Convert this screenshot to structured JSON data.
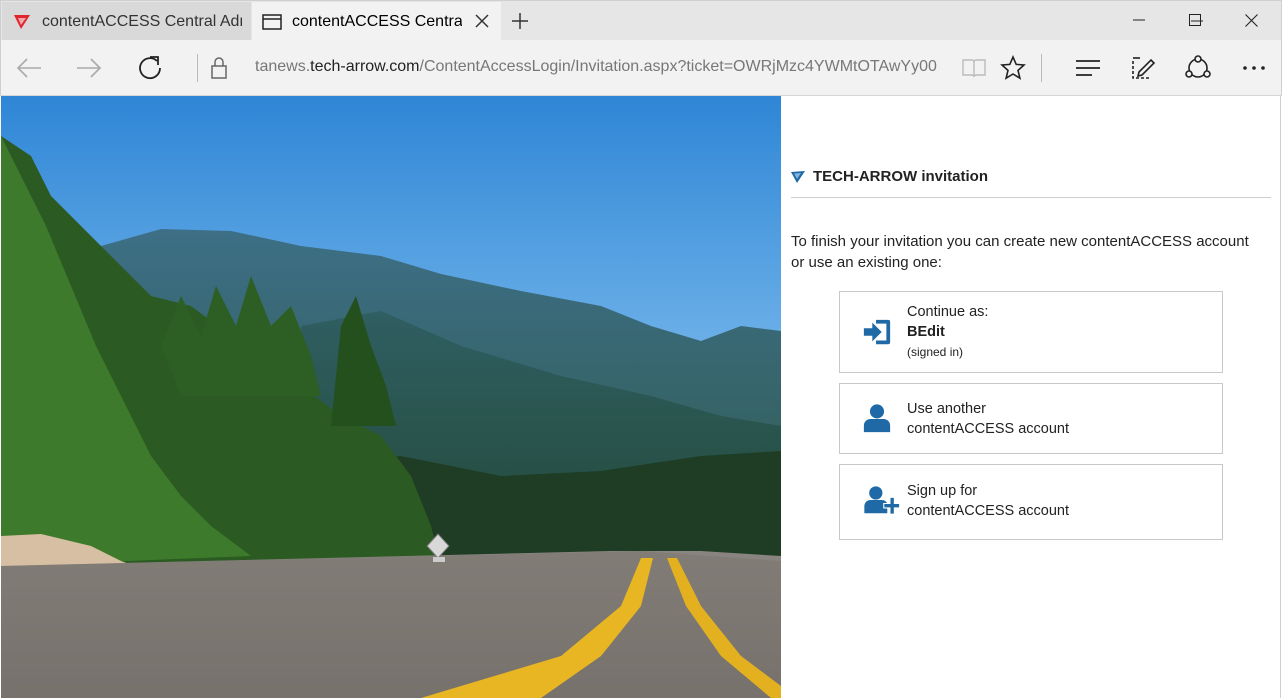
{
  "browser": {
    "tabs": [
      {
        "title": "contentACCESS Central Adn",
        "icon": "tech-arrow-logo-icon",
        "active": false
      },
      {
        "title": "contentACCESS Central",
        "icon": "page-icon",
        "active": true
      }
    ],
    "address": {
      "prefix": "tanews.",
      "host": "tech-arrow.com",
      "path": "/ContentAccessLogin/Invitation.aspx?ticket=OWRjMzc4YWMtOTAwYy00"
    },
    "toolbar_icons": [
      "back-icon",
      "forward-icon",
      "refresh-icon",
      "lock-icon",
      "reading-view-icon",
      "favorite-star-icon",
      "hub-icon",
      "web-note-icon",
      "share-icon",
      "more-icon"
    ],
    "window_controls": [
      "minimize-icon",
      "maximize-icon",
      "close-icon"
    ]
  },
  "panel": {
    "title": "TECH-ARROW invitation",
    "intro": "To finish your invitation you can create new contentACCESS account or use an existing one:",
    "options": [
      {
        "line1": "Continue as:",
        "bold": "BEdit",
        "small": "(signed in)",
        "icon": "sign-in-icon"
      },
      {
        "line1": "Use another",
        "line2": "contentACCESS account",
        "icon": "user-icon"
      },
      {
        "line1": "Sign up for",
        "line2": "contentACCESS account",
        "icon": "add-user-icon"
      }
    ]
  },
  "colors": {
    "brand_icon": "#1f6aa6",
    "logo_red": "#e0252d"
  }
}
